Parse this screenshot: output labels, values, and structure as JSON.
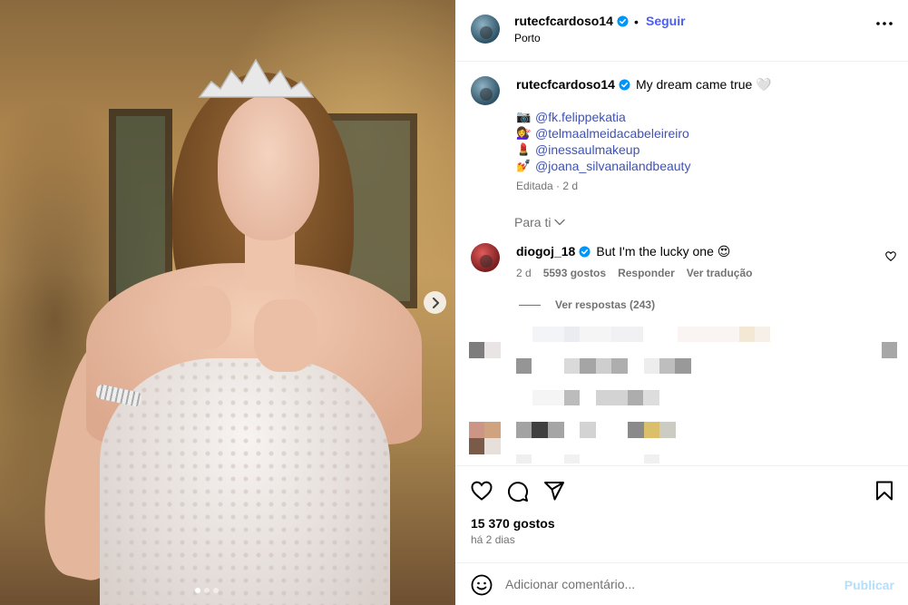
{
  "post": {
    "photo_alt": "bride portrait",
    "carousel": {
      "total_slides": 3,
      "active_index": 0
    }
  },
  "header": {
    "username": "rutecfcardoso14",
    "separator": "•",
    "follow_label": "Seguir",
    "location": "Porto"
  },
  "caption": {
    "username": "rutecfcardoso14",
    "text": "My dream came true 🤍",
    "mentions": [
      {
        "emoji": "📷",
        "handle": "@fk.felippekatia"
      },
      {
        "emoji": "💇‍♀️",
        "handle": "@telmaalmeidacabeleireiro"
      },
      {
        "emoji": "💄",
        "handle": "@inessaulmakeup"
      },
      {
        "emoji": "💅",
        "handle": "@joana_silvanailandbeauty"
      }
    ],
    "meta": "Editada · 2 d"
  },
  "for_you_label": "Para ti",
  "comment": {
    "username": "diogoj_18",
    "text": "But I'm the lucky one 😍",
    "age": "2 d",
    "likes": "5593 gostos",
    "reply_label": "Responder",
    "translate_label": "Ver tradução",
    "view_replies": "Ver respostas (243)"
  },
  "stats": {
    "likes": "15 370 gostos",
    "date": "há 2 dias"
  },
  "comment_box": {
    "placeholder": "Adicionar comentário...",
    "publish_label": "Publicar"
  },
  "colors": {
    "accent": "#4a5df9",
    "mention": "#3e52b8",
    "muted": "#737373",
    "publish_disabled": "#b2dffc"
  },
  "icons": [
    "verified-badge-icon",
    "more-options-icon",
    "chevron-right-icon",
    "chevron-down-icon",
    "heart-icon",
    "comment-icon",
    "share-icon",
    "bookmark-icon",
    "emoji-icon"
  ]
}
